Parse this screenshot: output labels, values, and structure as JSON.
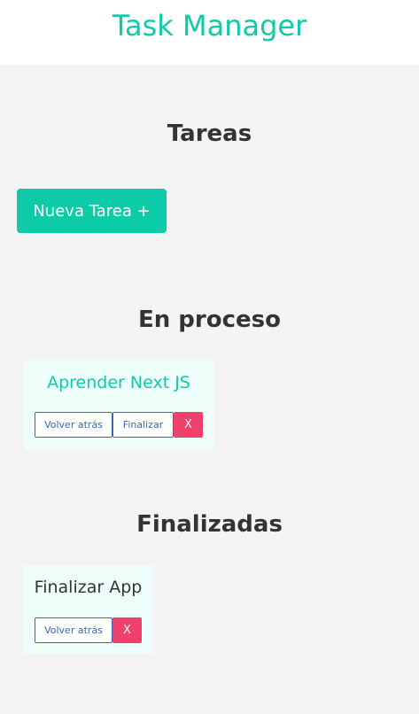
{
  "header": {
    "title": "Task Manager"
  },
  "tasks_section": {
    "title": "Tareas",
    "new_task_label": "Nueva Tarea +"
  },
  "in_progress_section": {
    "title": "En proceso",
    "cards": [
      {
        "title": "Aprender Next JS",
        "back_label": "Volver atrás",
        "finish_label": "Finalizar",
        "delete_label": "X"
      }
    ]
  },
  "finished_section": {
    "title": "Finalizadas",
    "cards": [
      {
        "title": "Finalizar App",
        "back_label": "Volver atrás",
        "delete_label": "X"
      }
    ]
  },
  "colors": {
    "accent": "#0ecba8",
    "card_background": "#effffb",
    "danger": "#f0406b",
    "outline": "#3a67b5",
    "page_background": "#f4f4f4"
  }
}
